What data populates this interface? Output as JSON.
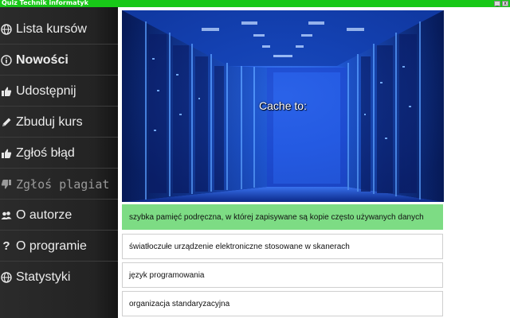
{
  "window": {
    "title": "Quiz Technik informatyk",
    "min_glyph": "_",
    "close_glyph": "x"
  },
  "sidebar": {
    "items": [
      {
        "label": "Lista kursów",
        "icon": "globe-icon"
      },
      {
        "label": "Nowości",
        "icon": "info-icon"
      },
      {
        "label": "Udostępnij",
        "icon": "thumbs-up-icon"
      },
      {
        "label": "Zbuduj kurs",
        "icon": "pencil-icon"
      },
      {
        "label": "Zgłoś błąd",
        "icon": "bug-icon"
      },
      {
        "label": "Zgłoś plagiat",
        "icon": "thumbs-down-icon"
      },
      {
        "label": "O autorze",
        "icon": "users-icon"
      },
      {
        "label": "O programie",
        "icon": "question-icon"
      },
      {
        "label": "Statystyki",
        "icon": "globe-icon"
      }
    ]
  },
  "quiz": {
    "question": "Cache to:",
    "answers": [
      {
        "text": "szybka pamięć podręczna, w której zapisywane są kopie często używanych danych",
        "state": "correct"
      },
      {
        "text": "światłoczułe urządzenie elektroniczne stosowane w skanerach",
        "state": "normal"
      },
      {
        "text": "język programowania",
        "state": "normal"
      },
      {
        "text": "organizacja standaryzacyjna",
        "state": "normal"
      }
    ],
    "correct_color": "#7ddc84"
  },
  "colors": {
    "titlebar": "#18c818",
    "sidebar": "#262626",
    "image_blue": "#1a4fd8"
  }
}
